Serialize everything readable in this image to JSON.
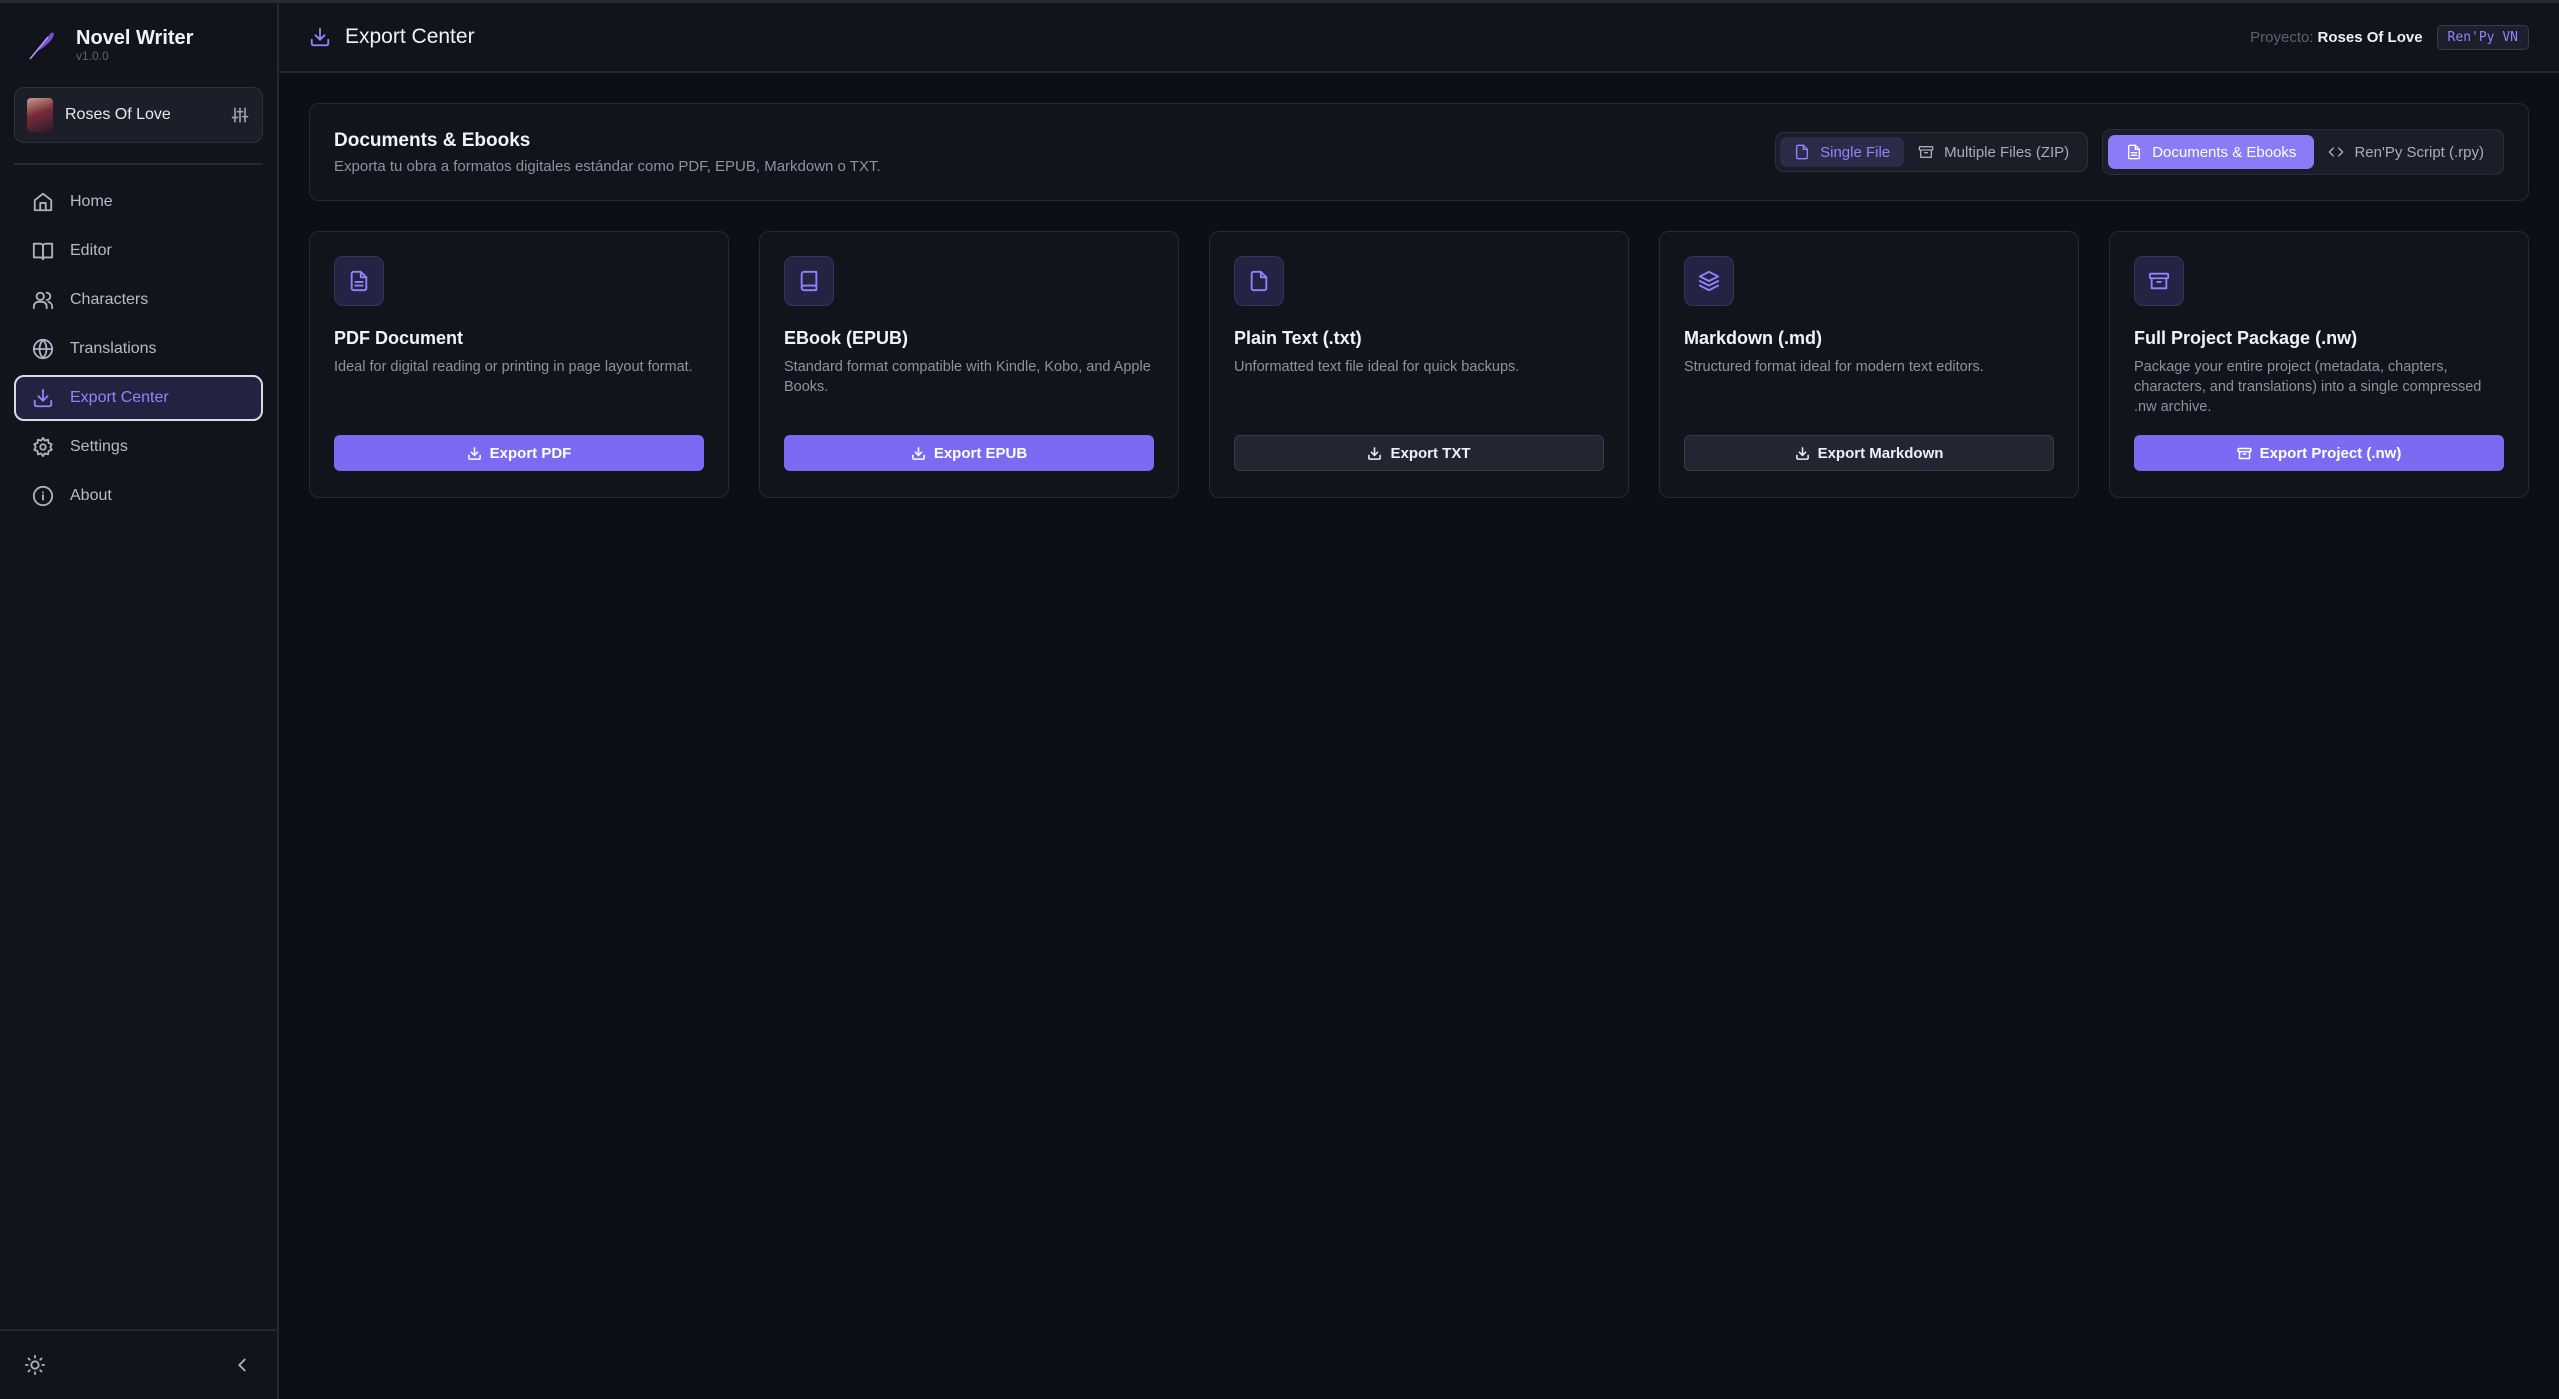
{
  "app": {
    "name": "Novel Writer",
    "version": "v1.0.0"
  },
  "project": {
    "name": "Roses Of Love"
  },
  "nav": [
    {
      "label": "Home",
      "icon": "home-icon"
    },
    {
      "label": "Editor",
      "icon": "book-icon"
    },
    {
      "label": "Characters",
      "icon": "users-icon"
    },
    {
      "label": "Translations",
      "icon": "globe-icon"
    },
    {
      "label": "Export Center",
      "icon": "download-icon",
      "active": true
    },
    {
      "label": "Settings",
      "icon": "gear-icon"
    },
    {
      "label": "About",
      "icon": "info-icon"
    }
  ],
  "topbar": {
    "title": "Export Center",
    "project_label": "Proyecto:",
    "project_value": "Roses Of Love",
    "engine_badge": "Ren'Py VN"
  },
  "header": {
    "title": "Documents & Ebooks",
    "subtitle": "Exporta tu obra a formatos digitales estándar como PDF, EPUB, Markdown o TXT.",
    "mode_toggle": {
      "single": "Single File",
      "multiple": "Multiple Files (ZIP)",
      "selected": "Single File"
    },
    "type_toggle": {
      "documents": "Documents & Ebooks",
      "renpy": "Ren'Py Script (.rpy)",
      "selected": "Documents & Ebooks"
    }
  },
  "cards": [
    {
      "title": "PDF Document",
      "desc": "Ideal for digital reading or printing in page layout format.",
      "button": "Export PDF",
      "style": "primary",
      "icon": "file-text-icon"
    },
    {
      "title": "EBook (EPUB)",
      "desc": "Standard format compatible with Kindle, Kobo, and Apple Books.",
      "button": "Export EPUB",
      "style": "primary",
      "icon": "book-icon"
    },
    {
      "title": "Plain Text (.txt)",
      "desc": "Unformatted text file ideal for quick backups.",
      "button": "Export TXT",
      "style": "secondary",
      "icon": "file-icon"
    },
    {
      "title": "Markdown (.md)",
      "desc": "Structured format ideal for modern text editors.",
      "button": "Export Markdown",
      "style": "secondary",
      "icon": "layers-icon"
    },
    {
      "title": "Full Project Package (.nw)",
      "desc": "Package your entire project (metadata, chapters, characters, and translations) into a single compressed .nw archive.",
      "button": "Export Project (.nw)",
      "style": "primary",
      "icon": "archive-icon"
    }
  ],
  "colors": {
    "accent": "#8a7cf7",
    "accent_text": "#8f86ff",
    "background": "#0d0f16",
    "panel": "#12141c"
  }
}
